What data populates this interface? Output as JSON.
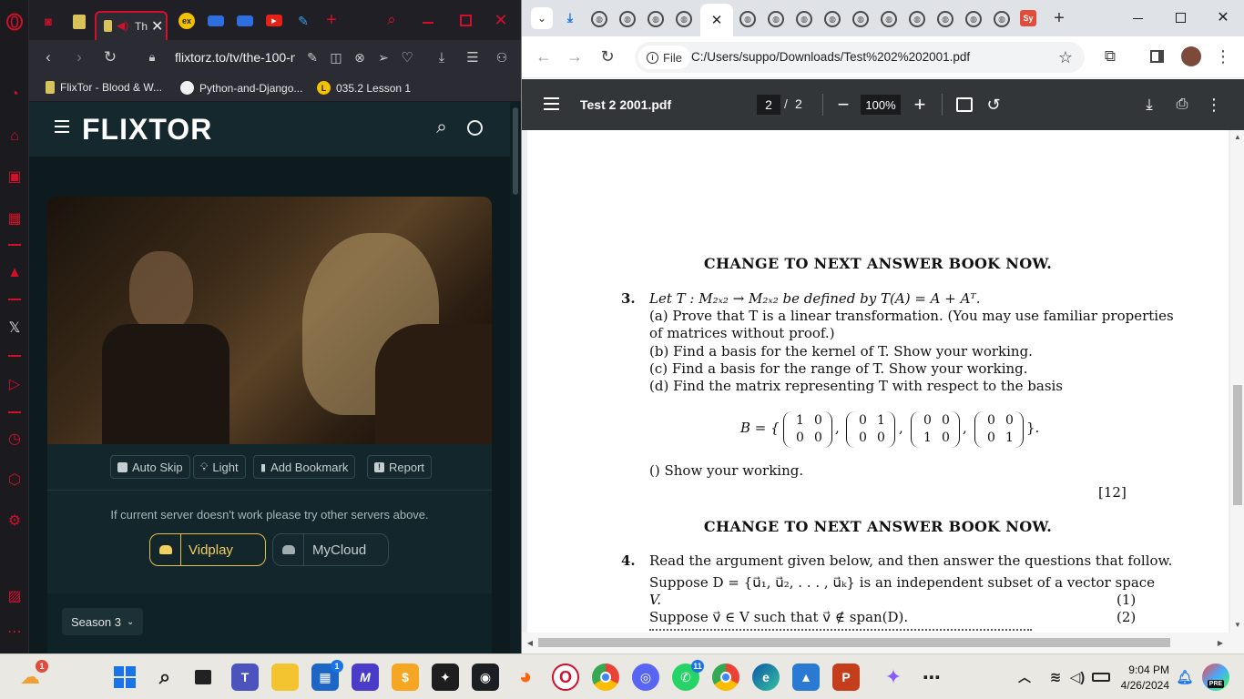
{
  "opera": {
    "tab_label": "Th",
    "url": "flixtorz.to/tv/the-100-n",
    "bookmarks": [
      {
        "label": "FlixTor - Blood & W..."
      },
      {
        "label": "Python-and-Django..."
      },
      {
        "label": "035.2 Lesson 1"
      }
    ]
  },
  "site": {
    "logo": "FLIXTOR",
    "actions": {
      "auto_skip": "Auto Skip",
      "light": "Light",
      "add_bookmark": "Add Bookmark",
      "report": "Report"
    },
    "server_note": "If current server doesn't work please try other servers above.",
    "servers": [
      {
        "label": "Vidplay",
        "active": true
      },
      {
        "label": "MyCloud",
        "active": false
      }
    ],
    "season_label": "Season 3"
  },
  "chrome": {
    "profile_tab_label": "Sy",
    "omnibox_chip": "File",
    "url": "C:/Users/suppo/Downloads/Test%202%202001.pdf"
  },
  "pdf": {
    "title": "Test 2 2001.pdf",
    "page_current": "2",
    "page_sep": "/",
    "page_total": "2",
    "zoom": "100%",
    "change_notice": "CHANGE TO NEXT ANSWER BOOK NOW.",
    "q3": {
      "number": "3.",
      "stem": "Let T : M₂ₓ₂ → M₂ₓ₂ be defined by T(A) = A + Aᵀ.",
      "a": "(a) Prove that T is a linear transformation. (You may use familiar properties",
      "a_cont": "of matrices without proof.)",
      "b": "(b) Find a basis for the kernel of T. Show your working.",
      "c": "(c) Find a basis for the range of T. Show your working.",
      "d": "(d) Find the matrix representing T with respect to the basis",
      "basis_label": "B = {",
      "basis_end": "}.",
      "matrices": [
        [
          "1",
          "0",
          "0",
          "0"
        ],
        [
          "0",
          "1",
          "0",
          "0"
        ],
        [
          "0",
          "0",
          "1",
          "0"
        ],
        [
          "0",
          "0",
          "0",
          "1"
        ]
      ],
      "show": "()  Show your working.",
      "marks": "[12]"
    },
    "q4": {
      "number": "4.",
      "intro": "Read the argument given below, and then answer the questions that follow.",
      "line1": "Suppose D = {u⃗₁, u⃗₂, . . . , u⃗ₖ} is an independent subset of a vector space",
      "line1_cont": "V.",
      "tag1": "(1)",
      "line2": "Suppose v⃗ ∈ V such that v⃗ ∉ span(D).",
      "tag2": "(2)"
    }
  },
  "taskbar": {
    "weather_badge": "1",
    "store_badge": "1",
    "whatsapp_badge": "11",
    "time": "9:04 PM",
    "date": "4/26/2024",
    "pre_badge": "PRE"
  }
}
